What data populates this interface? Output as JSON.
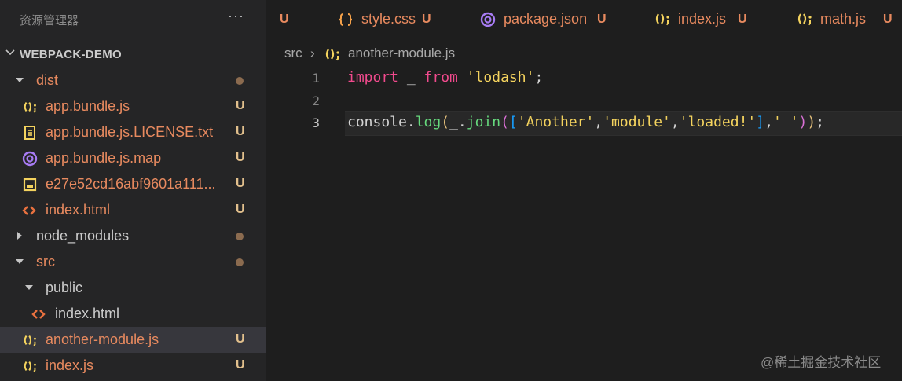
{
  "sidebar": {
    "title": "资源管理器",
    "more": "···",
    "project": "WEBPACK-DEMO",
    "items": [
      {
        "name": "dist",
        "badge": ""
      },
      {
        "name": "app.bundle.js",
        "badge": "U"
      },
      {
        "name": "app.bundle.js.LICENSE.txt",
        "badge": "U"
      },
      {
        "name": "app.bundle.js.map",
        "badge": "U"
      },
      {
        "name": "e27e52cd16abf9601a111...",
        "badge": "U"
      },
      {
        "name": "index.html",
        "badge": "U"
      },
      {
        "name": "node_modules",
        "badge": ""
      },
      {
        "name": "src",
        "badge": ""
      },
      {
        "name": "public",
        "badge": ""
      },
      {
        "name": "index.html",
        "badge": ""
      },
      {
        "name": "another-module.js",
        "badge": "U"
      },
      {
        "name": "index.js",
        "badge": "U"
      }
    ]
  },
  "tabs": [
    {
      "name": "",
      "badge": "U",
      "icon": "none"
    },
    {
      "name": "style.css",
      "badge": "U",
      "icon": "css-icon"
    },
    {
      "name": "package.json",
      "badge": "U",
      "icon": "json-icon"
    },
    {
      "name": "index.js",
      "badge": "U",
      "icon": "js-icon"
    },
    {
      "name": "math.js",
      "badge": "U",
      "icon": "js-icon"
    }
  ],
  "breadcrumb": {
    "folder": "src",
    "separator": "›",
    "file": "another-module.js"
  },
  "editor": {
    "line_numbers": [
      "1",
      "2",
      "3"
    ],
    "current_line": 3,
    "line1": {
      "kw1": "import",
      "mid": " _ ",
      "kw2": "from",
      "sp": " ",
      "str": "'lodash'",
      "end": ";"
    },
    "line3": {
      "obj": "console",
      "dot1": ".",
      "fn1": "log",
      "p1": "(",
      "us": "_",
      "dot2": ".",
      "fn2": "join",
      "p2": "(",
      "b1": "[",
      "s1": "'Another'",
      "c1": ",",
      "s2": "'module'",
      "c2": ",",
      "s3": "'loaded!'",
      "b2": "]",
      "c3": ",",
      "s4": "' '",
      "p3": ")",
      "p4": ")",
      "semi": ";"
    }
  },
  "watermark": "@稀土掘金技术社区",
  "colors": {
    "accent_modified": "#e88a5f",
    "badge_untracked": "#e2c08d",
    "keyword": "#f14a8d",
    "string": "#f4d35e",
    "function": "#66d97d"
  }
}
